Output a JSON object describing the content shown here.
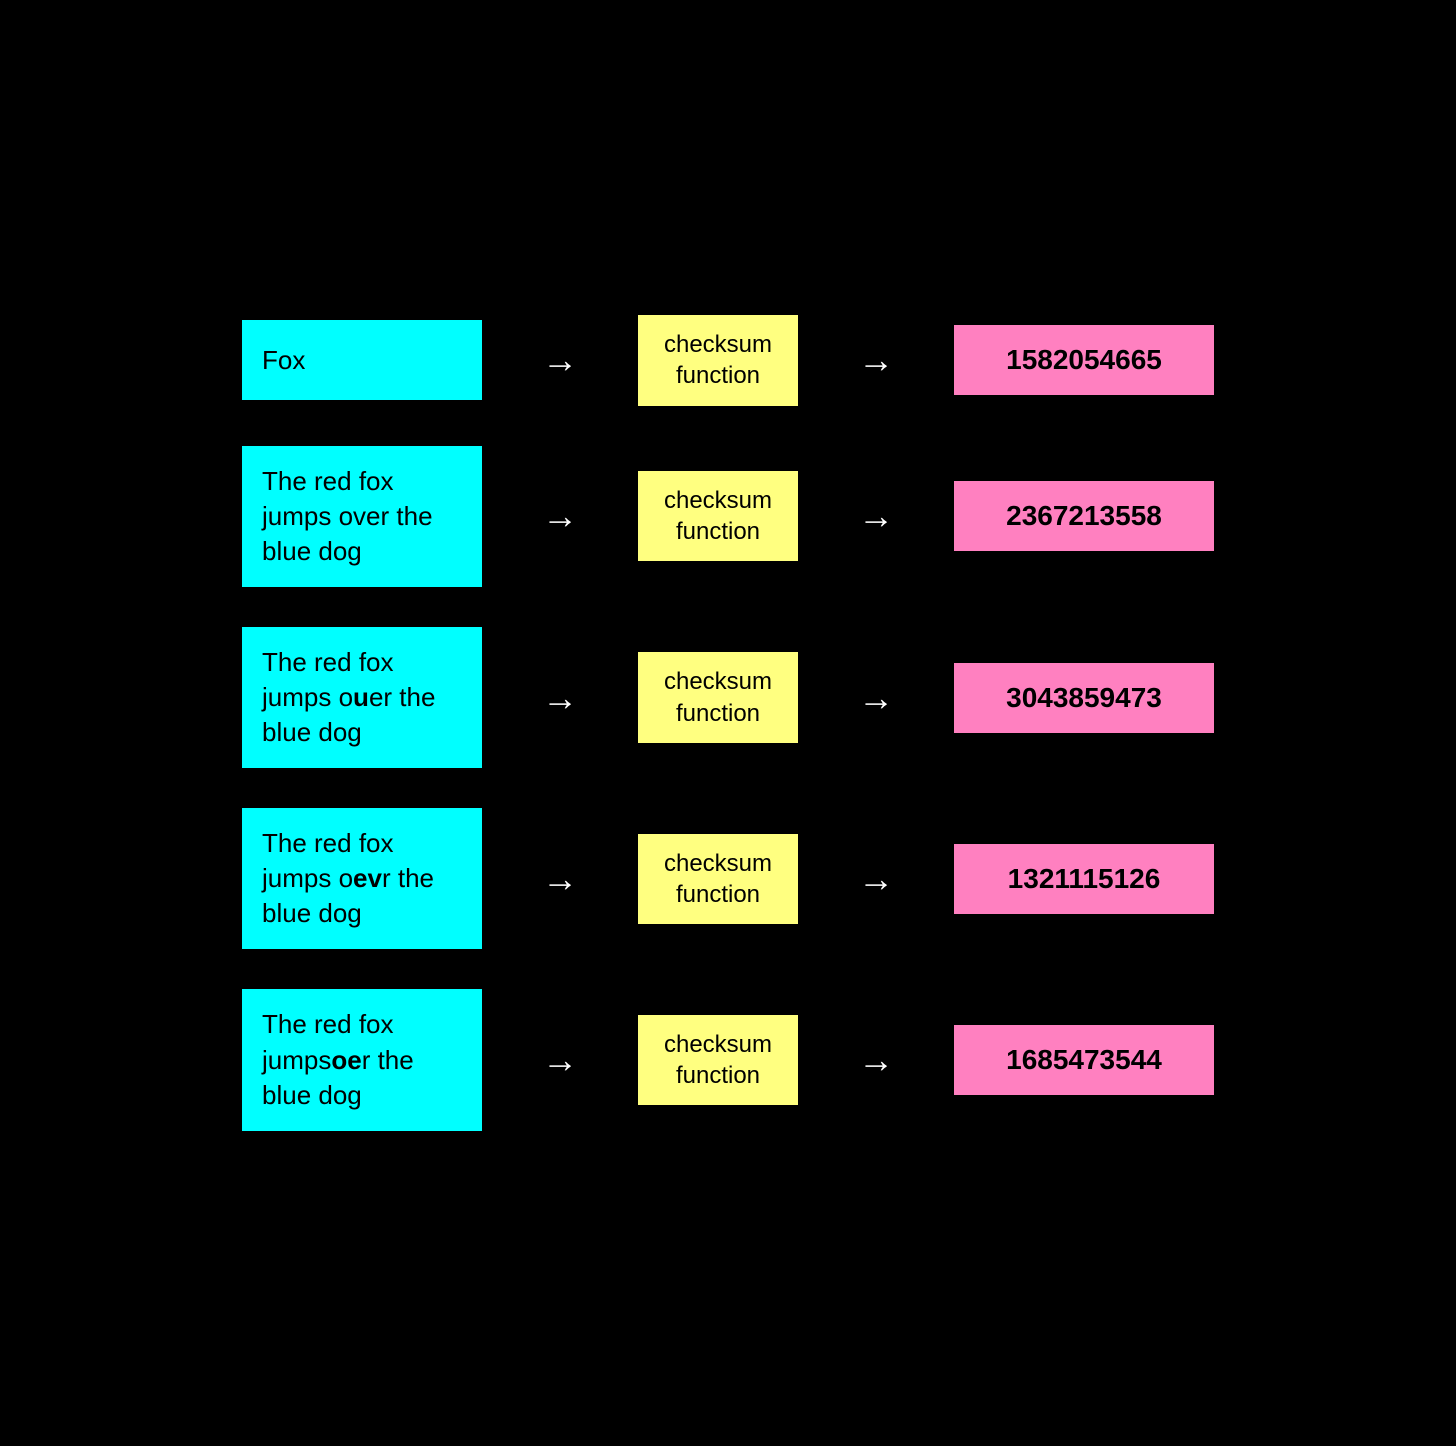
{
  "rows": [
    {
      "id": "row-1",
      "input_parts": [
        {
          "text": "Fox",
          "bold": false
        }
      ],
      "checksum_label": "checksum\nfunction",
      "output_value": "1582054665"
    },
    {
      "id": "row-2",
      "input_parts": [
        {
          "text": "The red fox jumps over the blue dog",
          "bold": false
        }
      ],
      "checksum_label": "checksum\nfunction",
      "output_value": "2367213558"
    },
    {
      "id": "row-3",
      "input_parts": [
        {
          "text": "The red fox jumps o",
          "bold": false
        },
        {
          "text": "u",
          "bold": true
        },
        {
          "text": "er the blue dog",
          "bold": false
        }
      ],
      "checksum_label": "checksum\nfunction",
      "output_value": "3043859473"
    },
    {
      "id": "row-4",
      "input_parts": [
        {
          "text": "The red fox jumps o",
          "bold": false
        },
        {
          "text": "ev",
          "bold": true
        },
        {
          "text": "r the blue dog",
          "bold": false
        }
      ],
      "checksum_label": "checksum\nfunction",
      "output_value": "1321115126"
    },
    {
      "id": "row-5",
      "input_parts": [
        {
          "text": "The red fox jumps",
          "bold": false
        },
        {
          "text": "oe",
          "bold": true
        },
        {
          "text": "r the blue dog",
          "bold": false
        }
      ],
      "checksum_label": "checksum\nfunction",
      "output_value": "1685473544"
    }
  ],
  "arrow_symbol": "→"
}
